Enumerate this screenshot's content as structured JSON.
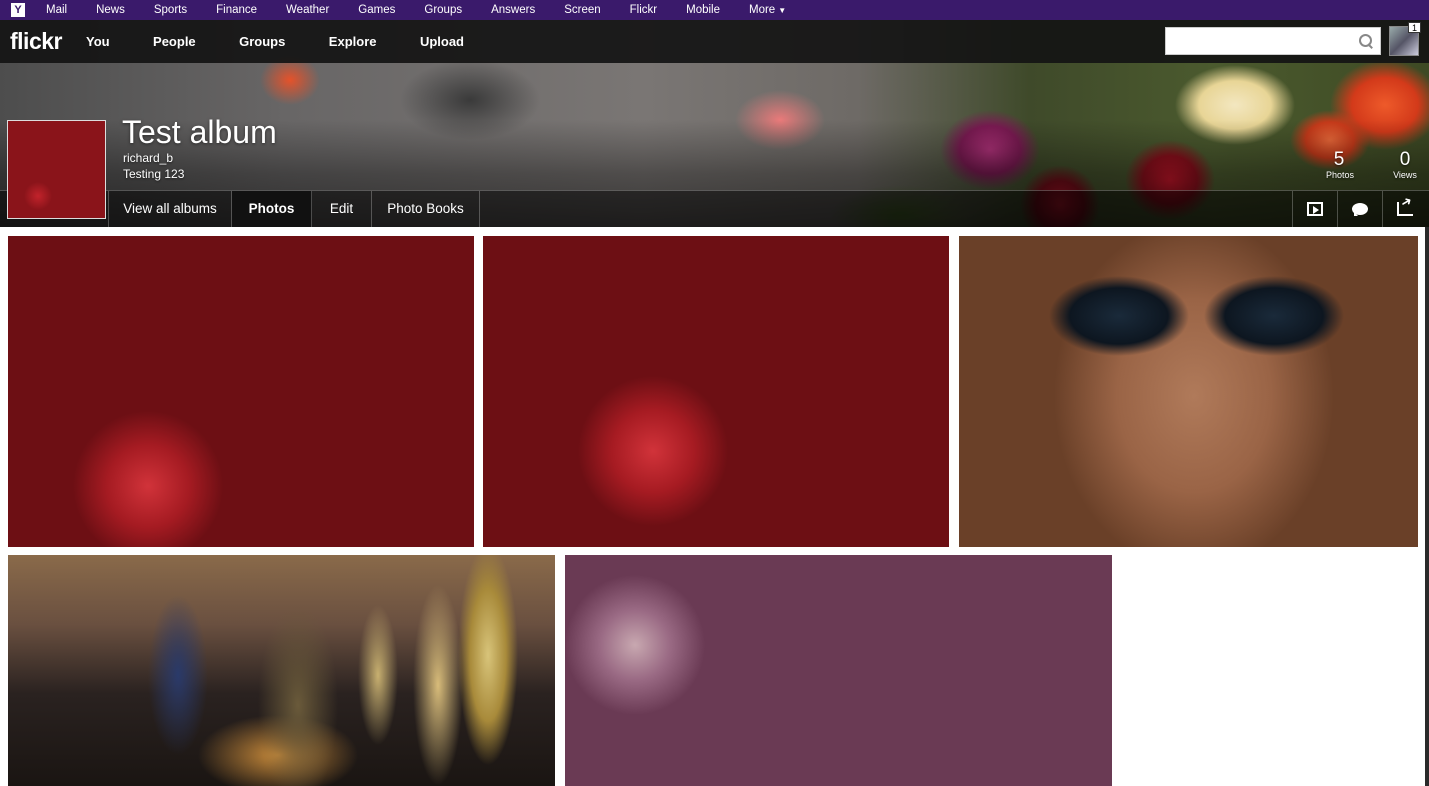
{
  "yahoo_bar": {
    "logo": "Y",
    "links": [
      "Mail",
      "News",
      "Sports",
      "Finance",
      "Weather",
      "Games",
      "Groups",
      "Answers",
      "Screen",
      "Flickr",
      "Mobile"
    ],
    "more_label": "More"
  },
  "flickr_nav": {
    "logo": "flickr",
    "links": [
      "You",
      "People",
      "Groups",
      "Explore",
      "Upload"
    ],
    "search_placeholder": "",
    "notification_count": "1"
  },
  "album": {
    "title": "Test album",
    "owner": "richard_b",
    "description": "Testing 123",
    "photos_count": "5",
    "photos_label": "Photos",
    "views_count": "0",
    "views_label": "Views"
  },
  "subnav": {
    "tabs": [
      "View all albums",
      "Photos",
      "Edit",
      "Photo Books"
    ],
    "active_tab": "Photos"
  },
  "photos": [
    {
      "subject": "apples at market"
    },
    {
      "subject": "apples in crates"
    },
    {
      "subject": "man with sunglasses"
    },
    {
      "subject": "city skyline at night"
    },
    {
      "subject": "turnips"
    }
  ],
  "colors": {
    "yahoo_bar": "#3a1a6b",
    "flickr_bar": "#141414",
    "active_tab": "#111111"
  }
}
